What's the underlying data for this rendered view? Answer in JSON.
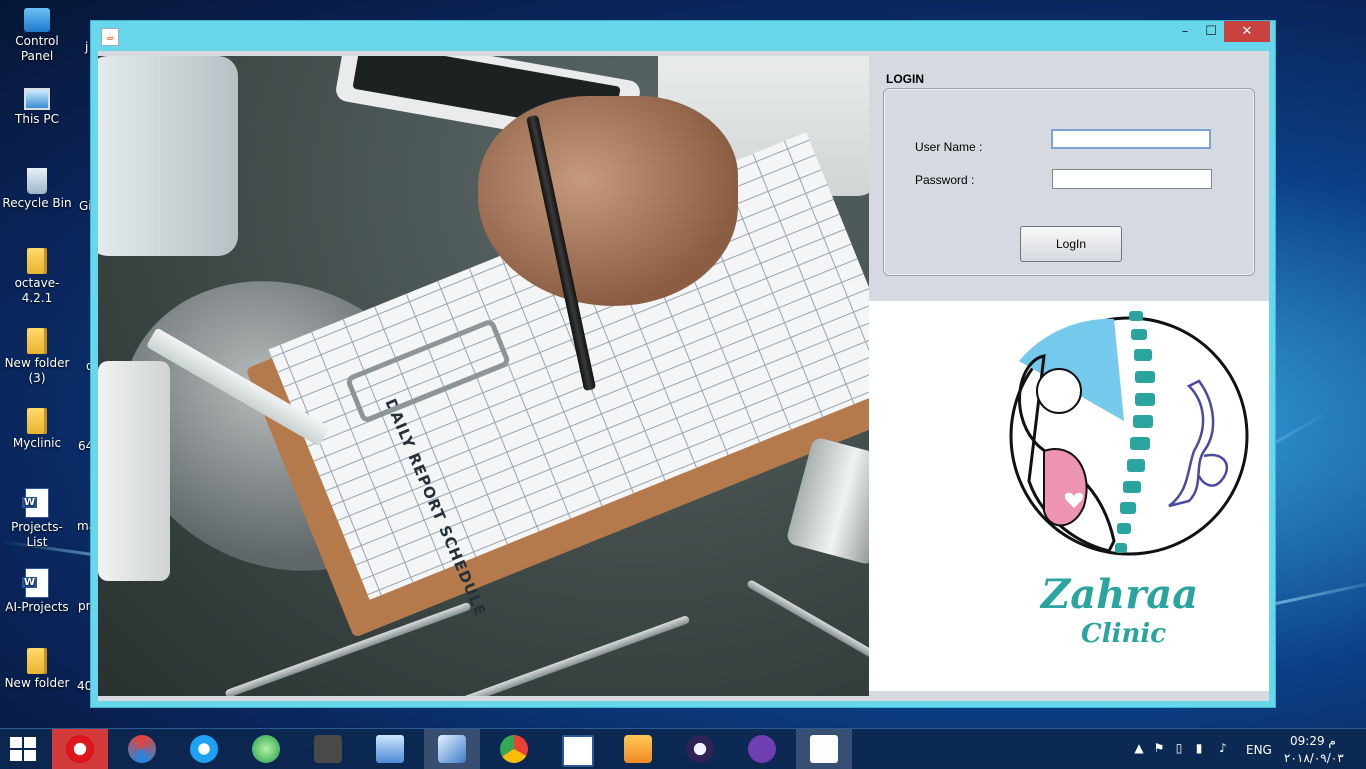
{
  "desktop": {
    "icons": [
      {
        "label": "Control\nPanel"
      },
      {
        "label": "This PC"
      },
      {
        "label": "Recycle Bin"
      },
      {
        "label": "octave-4.2.1"
      },
      {
        "label": "New folder\n(3)"
      },
      {
        "label": "Myclinic"
      },
      {
        "label": "Projects-List"
      },
      {
        "label": "AI-Projects"
      },
      {
        "label": "New folder"
      }
    ],
    "partial_labels": [
      "j",
      "Gi",
      "d",
      "64",
      "ma",
      "pr",
      "40"
    ]
  },
  "window": {
    "title_icon": "java-icon",
    "controls": {
      "minimize": "–",
      "maximize": "☐",
      "close": "✕"
    },
    "photo": {
      "sheet_heading": "DAILY REPORT SCHEDULE"
    },
    "login": {
      "title": "LOGIN",
      "username_label": "User Name :",
      "password_label": "Password :",
      "username_value": "",
      "password_value": "",
      "button_label": "LogIn"
    },
    "logo": {
      "line1": "Zahraa",
      "line2": "Clinic"
    }
  },
  "taskbar": {
    "apps": [
      "opera-icon",
      "browser-icon",
      "internet-explorer-icon",
      "app-icon",
      "sublime-icon",
      "remote-desktop-icon",
      "virtualbox-icon",
      "chrome-like-icon",
      "document-icon",
      "vlc-like-icon",
      "eclipse-icon",
      "github-icon",
      "java-icon"
    ],
    "lang": "ENG",
    "time": "م 09:29",
    "date": "٢٠١٨/٠٩/٠٣"
  }
}
